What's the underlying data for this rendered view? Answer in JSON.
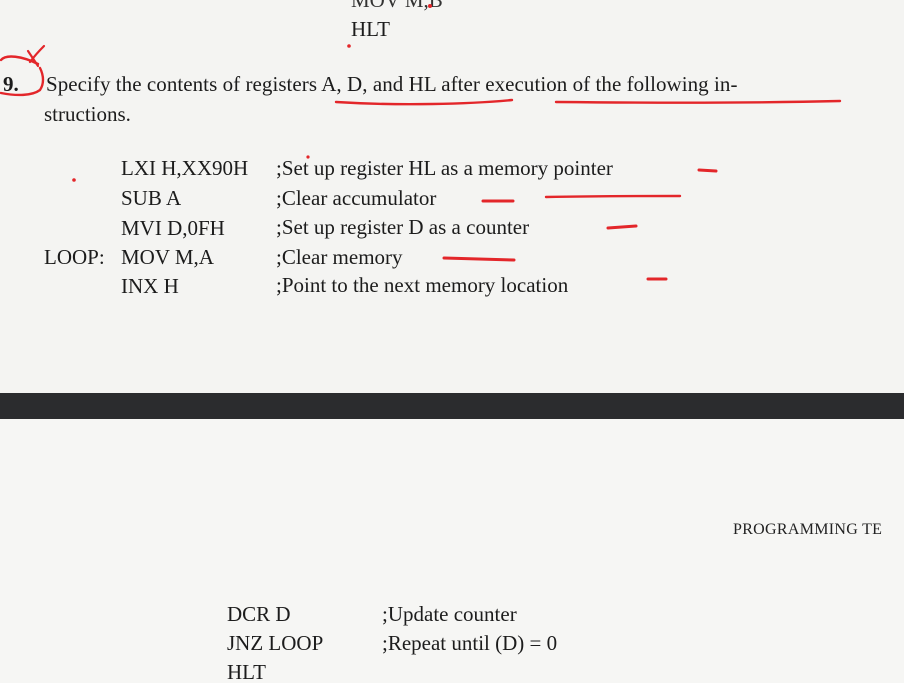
{
  "top_page": {
    "prev_lines": [
      "MOV M,B",
      "HLT"
    ],
    "question": {
      "number": "9.",
      "text_line1": "Specify the contents of registers A, D, and HL after execution of the following in-",
      "text_line2": "structions."
    },
    "code": [
      {
        "label": "",
        "instr": "LXI H,XX90H",
        "comment": ";Set up register HL as a memory pointer"
      },
      {
        "label": "",
        "instr": "SUB A",
        "comment": ";Clear accumulator"
      },
      {
        "label": "",
        "instr": "MVI D,0FH",
        "comment": ";Set up register D as a counter"
      },
      {
        "label": "LOOP:",
        "instr": "MOV M,A",
        "comment": ";Clear memory"
      },
      {
        "label": "",
        "instr": "INX H",
        "comment": ";Point to the next memory location"
      }
    ]
  },
  "bottom_page": {
    "running_head": "PROGRAMMING TE",
    "code": [
      {
        "instr": "DCR D",
        "comment": ";Update counter"
      },
      {
        "instr": "JNZ LOOP",
        "comment": ";Repeat until (D) = 0"
      },
      {
        "instr": "HLT",
        "comment": ""
      }
    ]
  },
  "colors": {
    "annotation": "#e3262a",
    "divider": "#2b2c2e",
    "paper": "#f4f4f2",
    "ink": "#1c1c1c"
  }
}
